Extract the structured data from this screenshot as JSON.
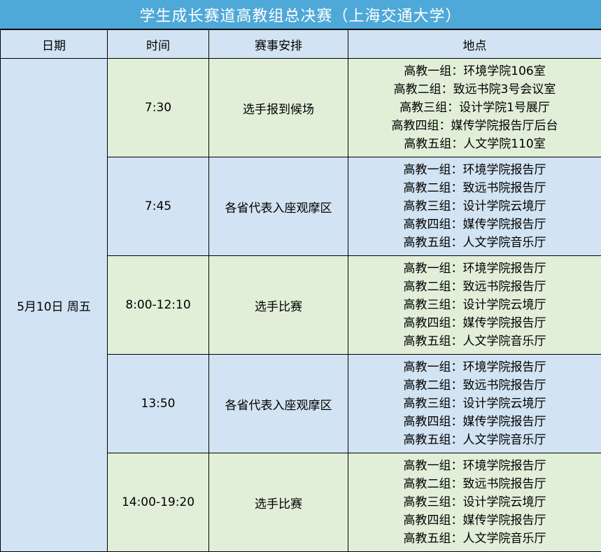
{
  "title": "学生成长赛道高教组总决赛（上海交通大学）",
  "headers": [
    "日期",
    "时间",
    "赛事安排",
    "地点"
  ],
  "date": "5月10日 周五",
  "rows": [
    {
      "time": "7:30",
      "event": "选手报到候场",
      "locations": [
        "高教一组：环境学院106室",
        "高教二组：致远书院3号会议室",
        "高教三组：设计学院1号展厅",
        "高教四组：媒传学院报告厅后台",
        "高教五组：人文学院110室"
      ]
    },
    {
      "time": "7:45",
      "event": "各省代表入座观摩区",
      "locations": [
        "高教一组：环境学院报告厅",
        "高教二组：致远书院报告厅",
        "高教三组：设计学院云境厅",
        "高教四组：媒传学院报告厅",
        "高教五组：人文学院音乐厅"
      ]
    },
    {
      "time": "8:00-12:10",
      "event": "选手比赛",
      "locations": [
        "高教一组：环境学院报告厅",
        "高教二组：致远书院报告厅",
        "高教三组：设计学院云境厅",
        "高教四组：媒传学院报告厅",
        "高教五组：人文学院音乐厅"
      ]
    },
    {
      "time": "13:50",
      "event": "各省代表入座观摩区",
      "locations": [
        "高教一组：环境学院报告厅",
        "高教二组：致远书院报告厅",
        "高教三组：设计学院云境厅",
        "高教四组：媒传学院报告厅",
        "高教五组：人文学院音乐厅"
      ]
    },
    {
      "time": "14:00-19:20",
      "event": "选手比赛",
      "locations": [
        "高教一组：环境学院报告厅",
        "高教二组：致远书院报告厅",
        "高教三组：设计学院云境厅",
        "高教四组：媒传学院报告厅",
        "高教五组：人文学院音乐厅"
      ]
    }
  ],
  "colors": {
    "title_bg": "#4ea8d8",
    "header_bg": "#d2e3f3",
    "green_row": "#e1efd9",
    "blue_row": "#d2e3f3"
  }
}
